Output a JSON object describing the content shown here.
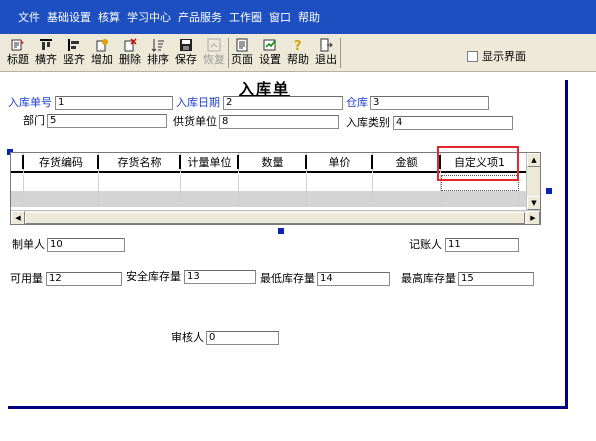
{
  "menu": {
    "items": [
      "文件",
      "基础设置",
      "核算",
      "学习中心",
      "产品服务",
      "工作圈",
      "窗口",
      "帮助"
    ]
  },
  "toolbar": {
    "buttons": [
      {
        "label": "标题",
        "icon": "title-icon",
        "enabled": true
      },
      {
        "label": "横齐",
        "icon": "align-horizontal-icon",
        "enabled": true
      },
      {
        "label": "竖齐",
        "icon": "align-vertical-icon",
        "enabled": true
      },
      {
        "label": "增加",
        "icon": "add-icon",
        "enabled": true
      },
      {
        "label": "删除",
        "icon": "delete-icon",
        "enabled": true
      },
      {
        "label": "排序",
        "icon": "sort-icon",
        "enabled": true
      },
      {
        "label": "保存",
        "icon": "save-icon",
        "enabled": true
      },
      {
        "label": "恢复",
        "icon": "restore-icon",
        "enabled": false
      },
      {
        "label": "页面",
        "icon": "page-icon",
        "enabled": true
      },
      {
        "label": "设置",
        "icon": "settings-icon",
        "enabled": true
      },
      {
        "label": "帮助",
        "icon": "help-icon",
        "enabled": true
      },
      {
        "label": "退出",
        "icon": "exit-icon",
        "enabled": true
      }
    ],
    "show_interface_label": "显示界面",
    "show_interface_checked": false
  },
  "form": {
    "title": "入库单",
    "fields": {
      "doc_no": {
        "label": "入库单号",
        "value": "1"
      },
      "doc_date": {
        "label": "入库日期",
        "value": "2"
      },
      "warehouse": {
        "label": "仓库",
        "value": "3"
      },
      "dept": {
        "label": "部门",
        "value": "5"
      },
      "supplier": {
        "label": "供货单位",
        "value": "8"
      },
      "in_type": {
        "label": "入库类别",
        "value": "4"
      },
      "maker": {
        "label": "制单人",
        "value": "10"
      },
      "bookkeeper": {
        "label": "记账人",
        "value": "11"
      },
      "available_qty": {
        "label": "可用量",
        "value": "12"
      },
      "safety_stock": {
        "label": "安全库存量",
        "value": "13"
      },
      "min_stock": {
        "label": "最低库存量",
        "value": "14"
      },
      "max_stock": {
        "label": "最高库存量",
        "value": "15"
      },
      "auditor": {
        "label": "审核人",
        "value": "0"
      }
    },
    "grid": {
      "columns": [
        "存货编码",
        "存货名称",
        "计量单位",
        "数量",
        "单价",
        "金额",
        "自定义项1"
      ]
    }
  },
  "colors": {
    "menubar": "#1d4fc0",
    "toolbar": "#ece9d8",
    "required_label": "#1a3fd0",
    "design_border": "#000080",
    "highlight": "#e5272d"
  }
}
